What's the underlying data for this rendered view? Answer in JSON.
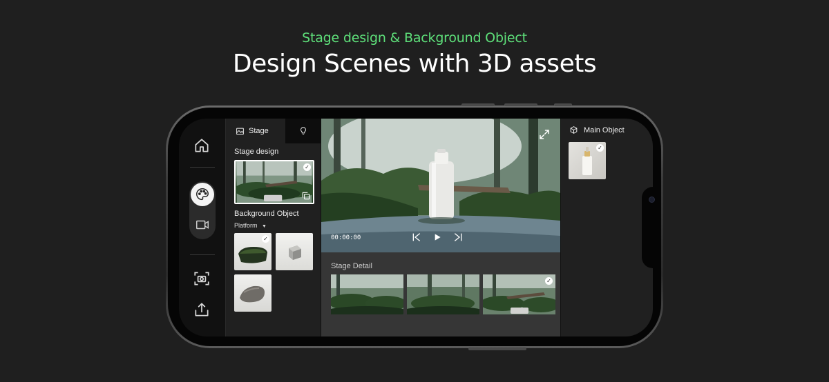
{
  "hero": {
    "subtitle": "Stage design & Background Object",
    "title": "Design Scenes with 3D assets"
  },
  "colors": {
    "accent_green": "#5ee07a",
    "background": "#1f1f1f",
    "panel": "#202020"
  },
  "toolbar": {
    "items": [
      {
        "icon": "home-icon",
        "label": "Home"
      },
      {
        "icon": "palette-icon",
        "label": "Stage design mode",
        "active": true
      },
      {
        "icon": "video-icon",
        "label": "Video mode"
      },
      {
        "icon": "screenshot-icon",
        "label": "Capture"
      },
      {
        "icon": "share-icon",
        "label": "Export"
      }
    ]
  },
  "stage_panel": {
    "tabs": [
      {
        "label": "Stage",
        "icon": "image-icon",
        "active": true
      },
      {
        "label": "",
        "icon": "lightbulb-icon",
        "active": false
      }
    ],
    "stage_design_label": "Stage design",
    "background_object_label": "Background Object",
    "platform_select": "Platform"
  },
  "viewport": {
    "timecode": "00:00:00",
    "stage_detail_label": "Stage Detail"
  },
  "main_object": {
    "label": "Main Object"
  }
}
